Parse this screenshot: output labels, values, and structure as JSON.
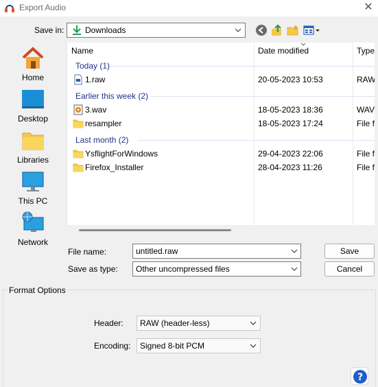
{
  "window": {
    "title": "Export Audio",
    "close_glyph": "✕"
  },
  "savein": {
    "label": "Save in:",
    "value": "Downloads"
  },
  "toolbar": {
    "icons": [
      "back-icon",
      "up-folder-icon",
      "new-folder-icon",
      "view-menu-icon"
    ]
  },
  "places": [
    {
      "label": "Home",
      "icon": "home-icon"
    },
    {
      "label": "Desktop",
      "icon": "desktop-icon"
    },
    {
      "label": "Libraries",
      "icon": "libraries-icon"
    },
    {
      "label": "This PC",
      "icon": "this-pc-icon"
    },
    {
      "label": "Network",
      "icon": "network-icon"
    }
  ],
  "filelist": {
    "columns": [
      "Name",
      "Date modified",
      "Type"
    ],
    "groups": [
      {
        "title": "Today (1)"
      },
      {
        "title": "Earlier this week (2)"
      },
      {
        "title": "Last month (2)"
      }
    ],
    "rows": [
      {
        "name": "1.raw",
        "date": "20-05-2023 10:53",
        "type": "RAW",
        "icon": "raw-file-icon"
      },
      {
        "name": "3.wav",
        "date": "18-05-2023 18:36",
        "type": "WAV",
        "icon": "wav-file-icon"
      },
      {
        "name": "resampler",
        "date": "18-05-2023 17:24",
        "type": "File fo",
        "icon": "folder-icon"
      },
      {
        "name": "YsflightForWindows",
        "date": "29-04-2023 22:06",
        "type": "File fo",
        "icon": "folder-icon"
      },
      {
        "name": "Firefox_Installer",
        "date": "28-04-2023 11:26",
        "type": "File fo",
        "icon": "folder-icon"
      }
    ]
  },
  "filename": {
    "label": "File name:",
    "value": "untitled.raw"
  },
  "savetype": {
    "label": "Save as type:",
    "value": "Other uncompressed files"
  },
  "buttons": {
    "save": "Save",
    "cancel": "Cancel",
    "help": "?"
  },
  "format": {
    "title": "Format Options",
    "header_label": "Header:",
    "header_value": "RAW (header-less)",
    "encoding_label": "Encoding:",
    "encoding_value": "Signed 8-bit PCM"
  },
  "colors": {
    "accent": "#0f6cbd",
    "group_text": "#1e3287",
    "folder": "#f5c84a"
  }
}
